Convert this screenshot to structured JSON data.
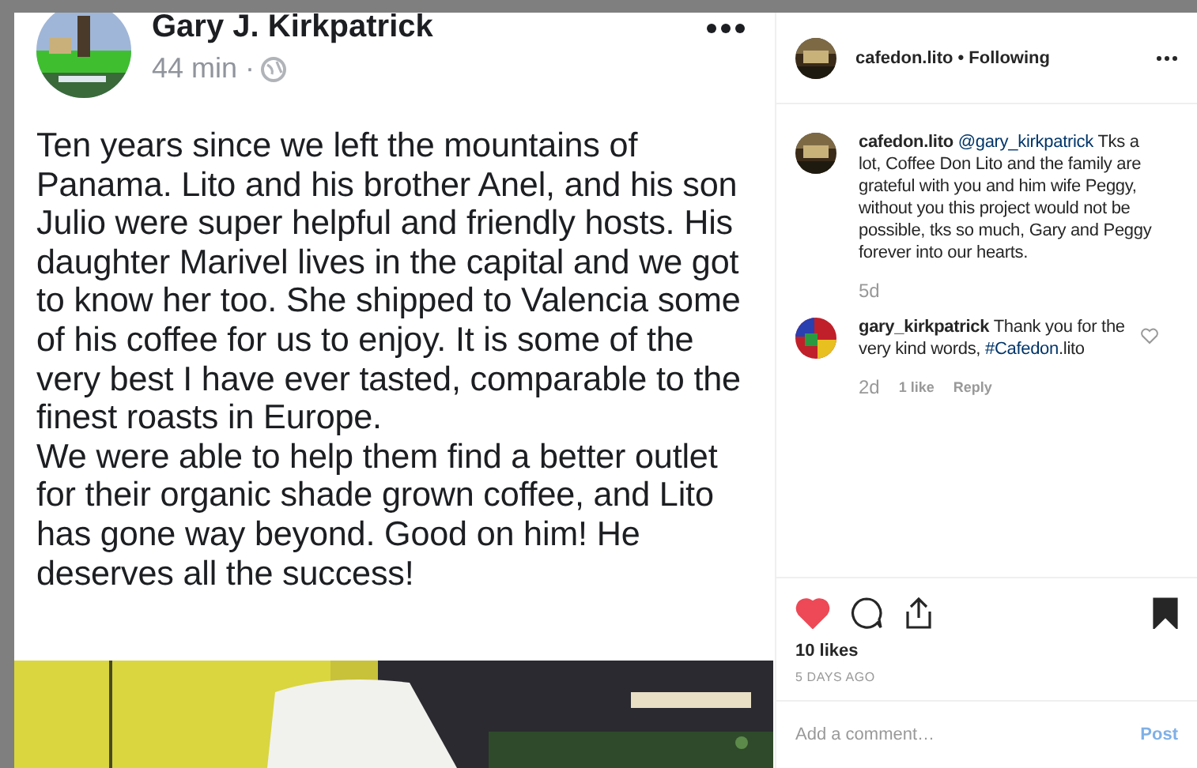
{
  "post_image": {
    "author": "Gary J. Kirkpatrick",
    "time": "44 min ·",
    "paragraphs": [
      "Ten years since we left the mountains of Panama. Lito and his brother Anel, and his son Julio were super helpful and friendly hosts. His daughter Marivel lives in the capital and we got to know her too. She shipped to Valencia some of his coffee for us to enjoy. It is some of the very best I have ever tasted, comparable to the finest roasts in Europe.",
      "We were able to help them find a better outlet for their organic shade grown coffee, and Lito has gone way beyond. Good on him! He deserves all the success!"
    ]
  },
  "header": {
    "username": "cafedon.lito",
    "follow": "• Following"
  },
  "comments": [
    {
      "username": "cafedon.lito",
      "parts": [
        {
          "kind": "link",
          "text": "@gary_kirkpatrick"
        },
        {
          "kind": "plain",
          "text": " Tks a lot, Coffee Don Lito and the family are grateful with you and him wife Peggy, without you this project would not be possible, tks so much, Gary and Peggy forever into our hearts."
        }
      ],
      "age": "5d"
    },
    {
      "username": "gary_kirkpatrick",
      "parts": [
        {
          "kind": "plain",
          "text": "Thank you for the very kind words, "
        },
        {
          "kind": "link",
          "text": "#Cafedon"
        },
        {
          "kind": "plain",
          "text": ".lito"
        }
      ],
      "age": "2d",
      "likes": "1 like",
      "reply": "Reply",
      "liked": false
    }
  ],
  "actions": {
    "liked": true,
    "saved": true
  },
  "likes": "10 likes",
  "date": "5 DAYS AGO",
  "comment_box": {
    "placeholder": "Add a comment…",
    "post": "Post",
    "disabled": true
  }
}
